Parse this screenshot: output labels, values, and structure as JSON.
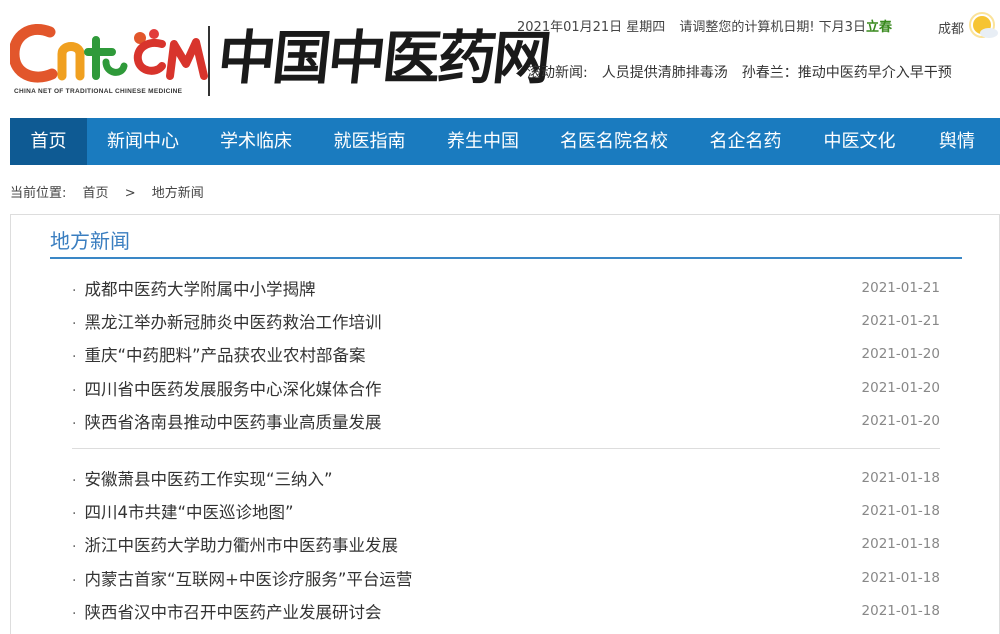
{
  "header": {
    "logo_caption": "CHINA NET OF TRADITIONAL CHINESE MEDICINE",
    "logo_cn": "中国中医药网",
    "date_text": "2021年01月21日 星期四",
    "reminder": "请调整您的计算机日期!",
    "next_term_prefix": "下月3日",
    "next_term": "立春",
    "city": "成都",
    "ticker_label": "滚动新闻:",
    "ticker_items": [
      "人员提供清肺排毒汤",
      "孙春兰：推动中医药早介入早干预"
    ]
  },
  "nav": [
    {
      "label": "首页",
      "active": true
    },
    {
      "label": "新闻中心"
    },
    {
      "label": "学术临床"
    },
    {
      "label": "就医指南"
    },
    {
      "label": "养生中国"
    },
    {
      "label": "名医名院名校"
    },
    {
      "label": "名企名药"
    },
    {
      "label": "中医文化"
    },
    {
      "label": "舆情"
    }
  ],
  "breadcrumb": {
    "prefix": "当前位置:",
    "home": "首页",
    "separator": ">",
    "current": "地方新闻"
  },
  "section": {
    "title": "地方新闻"
  },
  "news_group_1": [
    {
      "title": "成都中医药大学附属中小学揭牌",
      "date": "2021-01-21"
    },
    {
      "title": "黑龙江举办新冠肺炎中医药救治工作培训",
      "date": "2021-01-21"
    },
    {
      "title": "重庆“中药肥料”产品获农业农村部备案",
      "date": "2021-01-20"
    },
    {
      "title": "四川省中医药发展服务中心深化媒体合作",
      "date": "2021-01-20"
    },
    {
      "title": "陕西省洛南县推动中医药事业高质量发展",
      "date": "2021-01-20"
    }
  ],
  "news_group_2": [
    {
      "title": "安徽萧县中医药工作实现“三纳入”",
      "date": "2021-01-18"
    },
    {
      "title": "四川4市共建“中医巡诊地图”",
      "date": "2021-01-18"
    },
    {
      "title": "浙江中医药大学助力衢州市中医药事业发展",
      "date": "2021-01-18"
    },
    {
      "title": "内蒙古首家“互联网+中医诊疗服务”平台运营",
      "date": "2021-01-18"
    },
    {
      "title": "陕西省汉中市召开中医药产业发展研讨会",
      "date": "2021-01-18"
    }
  ],
  "colors": {
    "nav_bg": "#1a7bbf",
    "nav_active": "#0e5a93",
    "section_title": "#3a7ec0",
    "jieqi": "#3a8a1f"
  }
}
